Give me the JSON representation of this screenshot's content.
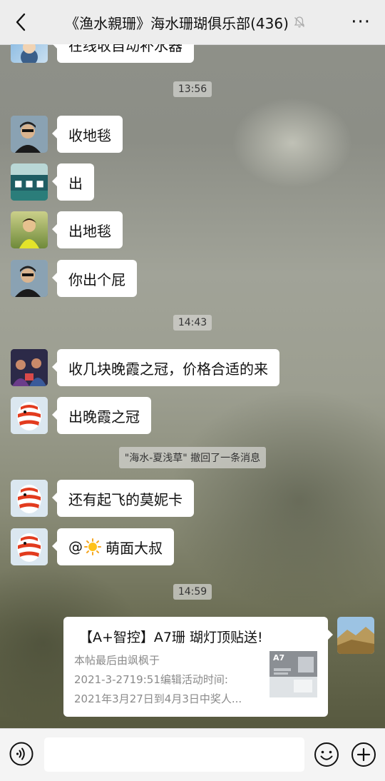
{
  "header": {
    "title": "《渔水親珊》海水珊瑚俱乐部(436)",
    "back_icon": "chevron-left-icon",
    "mute_icon": "bell-off-icon",
    "more_icon": "ellipsis-icon"
  },
  "messages": {
    "m0": {
      "text": "在线收自动补水器"
    },
    "t1": "13:56",
    "m1": {
      "text": "收地毯"
    },
    "m2": {
      "text": "出"
    },
    "m3": {
      "text": "出地毯"
    },
    "m4": {
      "text": "你出个屁"
    },
    "t2": "14:43",
    "m5": {
      "text": "收几块晚霞之冠，价格合适的来"
    },
    "m6": {
      "text": "出晚霞之冠"
    },
    "sys1": "\"海水-夏浅草\" 撤回了一条消息",
    "m7": {
      "text": "还有起飞的莫妮卡"
    },
    "m8": {
      "mention": "@",
      "emoji": "sun-emoji",
      "text": "萌面大叔"
    },
    "t3": "14:59"
  },
  "card": {
    "title": "【A+智控】A7珊 瑚灯顶贴送!",
    "desc_line1": "本帖最后由飒枫于",
    "desc_line2": "2021-3-2719:51编辑活动时间:",
    "desc_line3": "2021年3月27日到4月3日中奖人...",
    "thumb_label": "A7"
  },
  "bottom": {
    "voice_icon": "voice-icon",
    "emoji_icon": "smiley-icon",
    "plus_icon": "plus-circle-icon"
  }
}
